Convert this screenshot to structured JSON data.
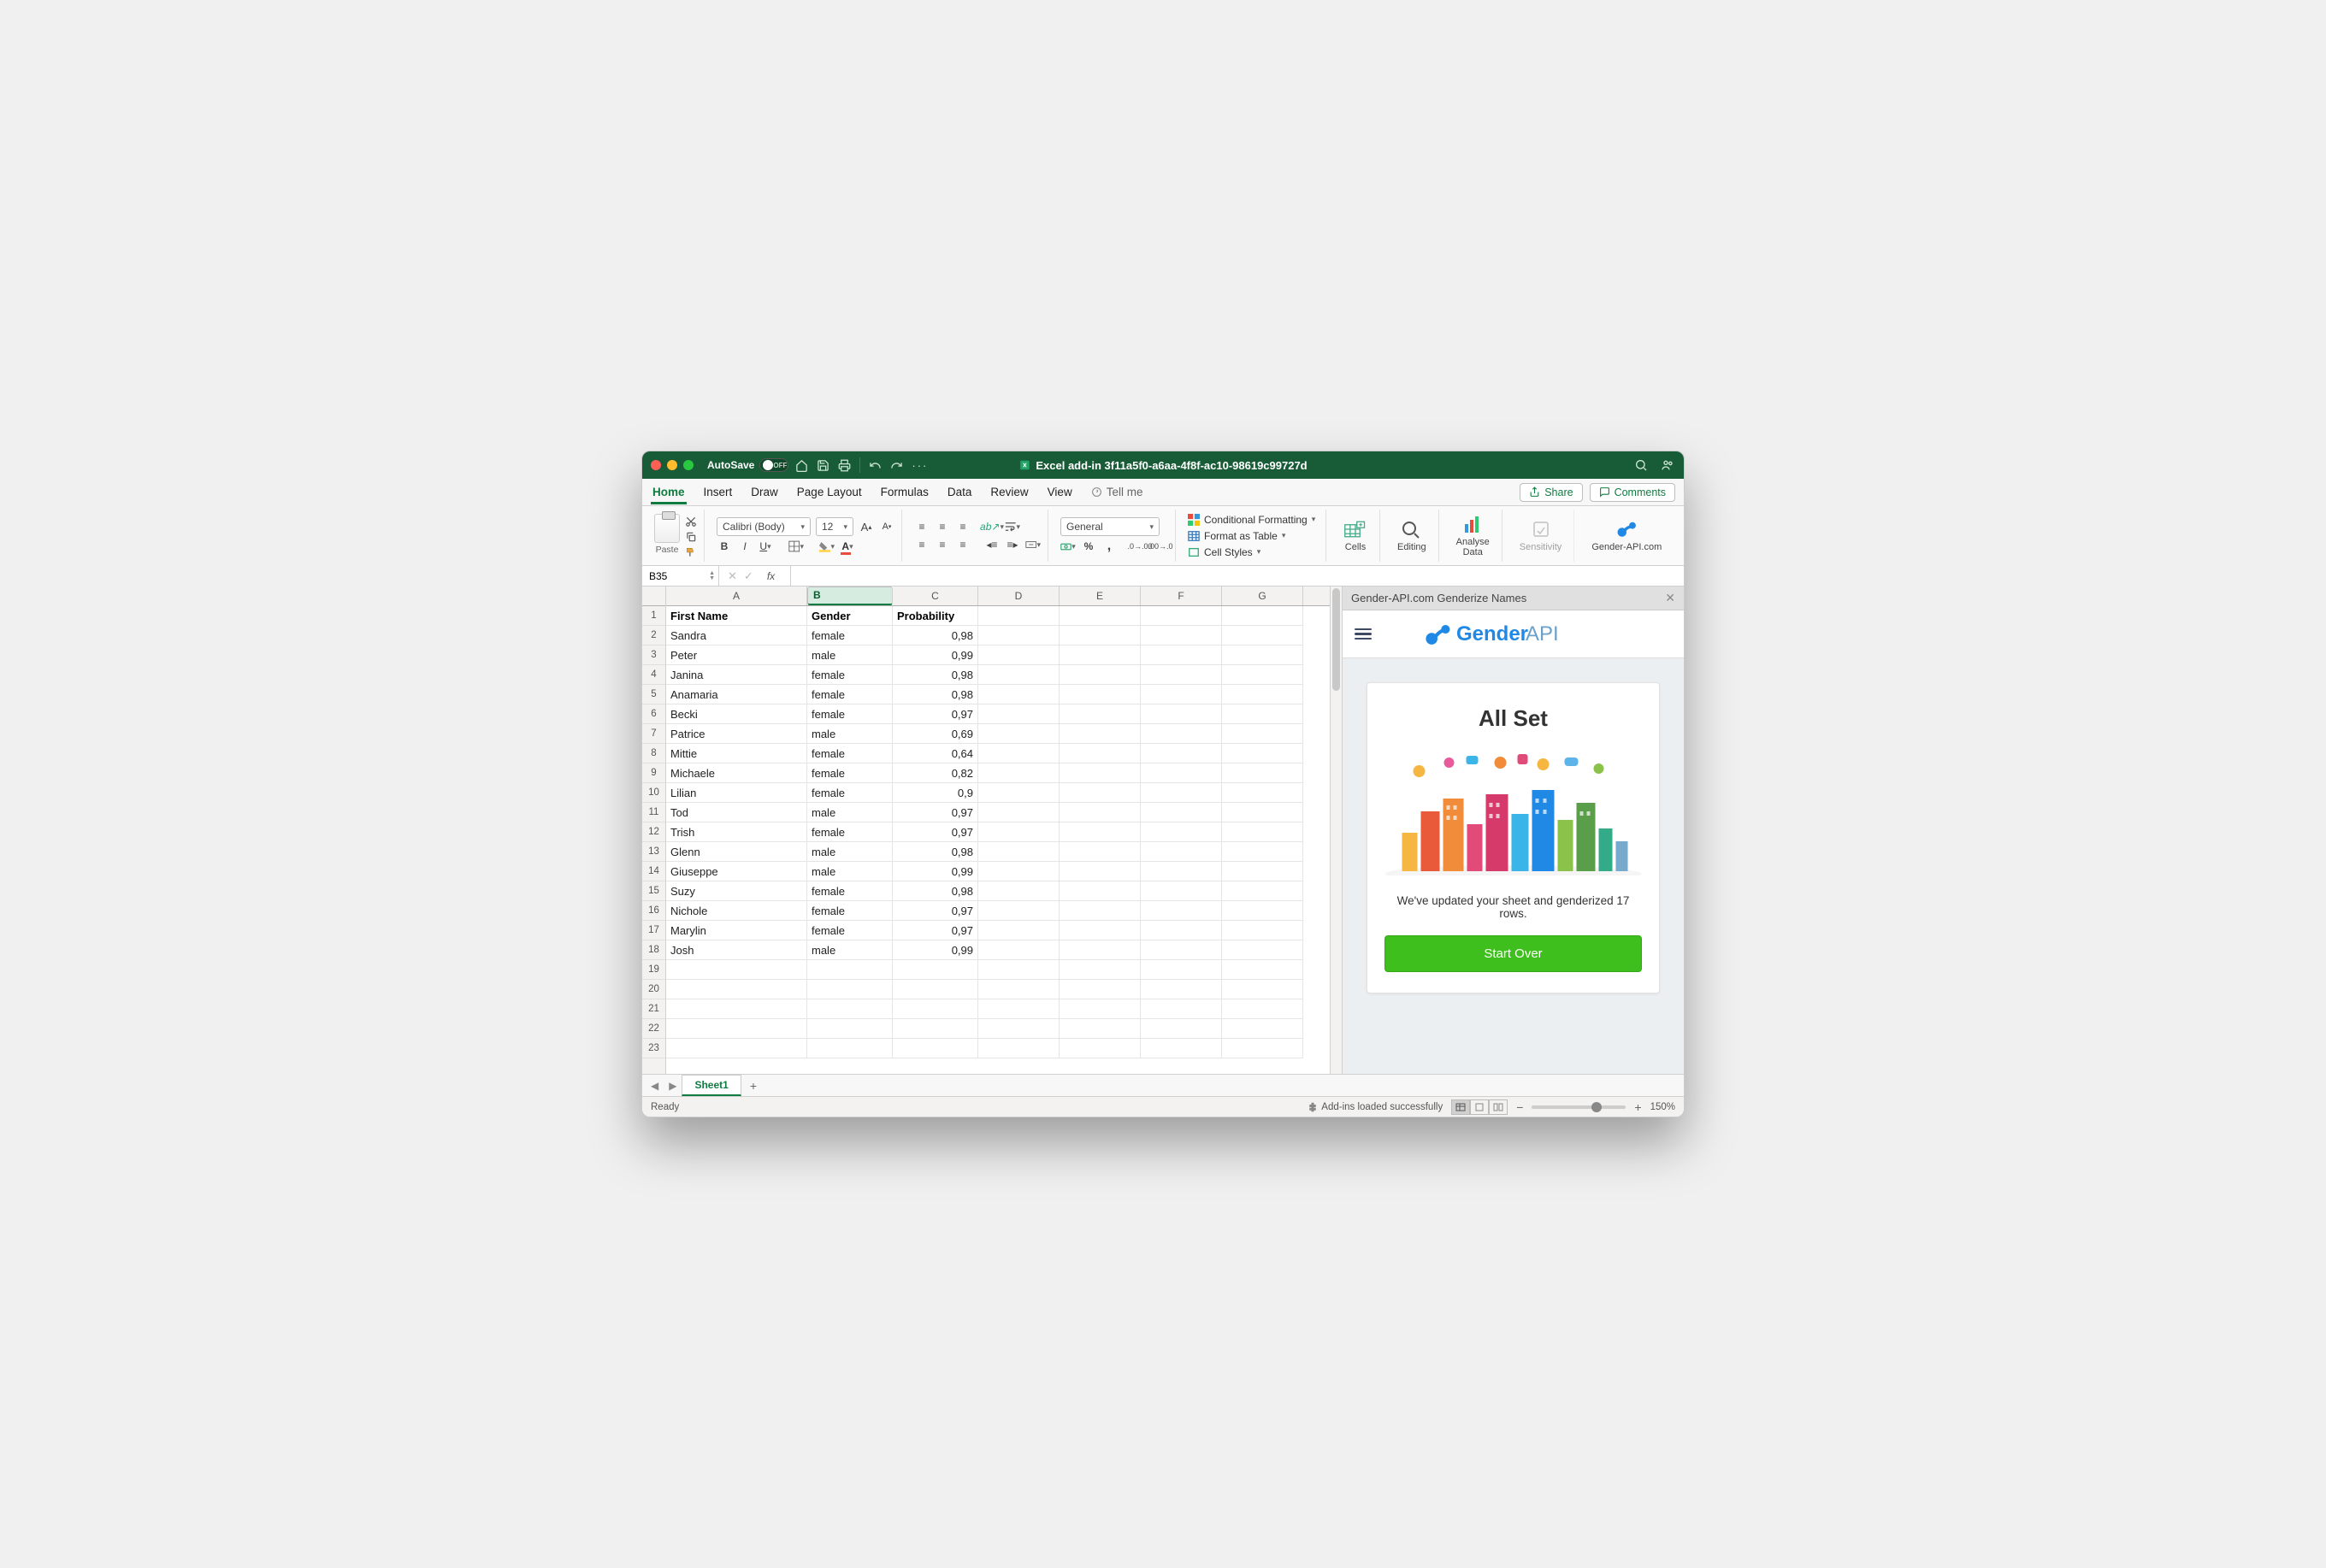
{
  "titlebar": {
    "autosave_label": "AutoSave",
    "autosave_state": "OFF",
    "doc_title": "Excel add-in 3f11a5f0-a6aa-4f8f-ac10-98619c99727d"
  },
  "ribbon_tabs": [
    "Home",
    "Insert",
    "Draw",
    "Page Layout",
    "Formulas",
    "Data",
    "Review",
    "View"
  ],
  "tell_me": "Tell me",
  "share_label": "Share",
  "comments_label": "Comments",
  "font": {
    "name": "Calibri (Body)",
    "size": "12"
  },
  "paste_label": "Paste",
  "number_format": "General",
  "cond_fmt": "Conditional Formatting",
  "fmt_table": "Format as Table",
  "cell_styles": "Cell Styles",
  "cells_label": "Cells",
  "editing_label": "Editing",
  "analyse_label": "Analyse\nData",
  "sensitivity_label": "Sensitivity",
  "genderapi_label": "Gender-API.com",
  "namebox": "B35",
  "columns": [
    "A",
    "B",
    "C",
    "D",
    "E",
    "F",
    "G"
  ],
  "col_widths": {
    "A": 165,
    "B": 100,
    "C": 100,
    "other": 95
  },
  "headers": {
    "A": "First Name",
    "B": "Gender",
    "C": "Probability"
  },
  "rows": [
    {
      "n": "Sandra",
      "g": "female",
      "p": "0,98"
    },
    {
      "n": "Peter",
      "g": "male",
      "p": "0,99"
    },
    {
      "n": "Janina",
      "g": "female",
      "p": "0,98"
    },
    {
      "n": "Anamaria",
      "g": "female",
      "p": "0,98"
    },
    {
      "n": "Becki",
      "g": "female",
      "p": "0,97"
    },
    {
      "n": "Patrice",
      "g": "male",
      "p": "0,69"
    },
    {
      "n": "Mittie",
      "g": "female",
      "p": "0,64"
    },
    {
      "n": "Michaele",
      "g": "female",
      "p": "0,82"
    },
    {
      "n": "Lilian",
      "g": "female",
      "p": "0,9"
    },
    {
      "n": "Tod",
      "g": "male",
      "p": "0,97"
    },
    {
      "n": "Trish",
      "g": "female",
      "p": "0,97"
    },
    {
      "n": "Glenn",
      "g": "male",
      "p": "0,98"
    },
    {
      "n": "Giuseppe",
      "g": "male",
      "p": "0,99"
    },
    {
      "n": "Suzy",
      "g": "female",
      "p": "0,98"
    },
    {
      "n": "Nichole",
      "g": "female",
      "p": "0,97"
    },
    {
      "n": "Marylin",
      "g": "female",
      "p": "0,97"
    },
    {
      "n": "Josh",
      "g": "male",
      "p": "0,99"
    }
  ],
  "empty_rows": [
    19,
    20,
    21,
    22,
    23
  ],
  "panel": {
    "title": "Gender-API.com Genderize Names",
    "logo_a": "Gender",
    "logo_b": "API",
    "card_title": "All Set",
    "card_msg": "We've updated your sheet and genderized 17 rows.",
    "button": "Start Over"
  },
  "sheet_tab": "Sheet1",
  "status": {
    "ready": "Ready",
    "addins": "Add-ins loaded successfully",
    "zoom": "150%"
  }
}
